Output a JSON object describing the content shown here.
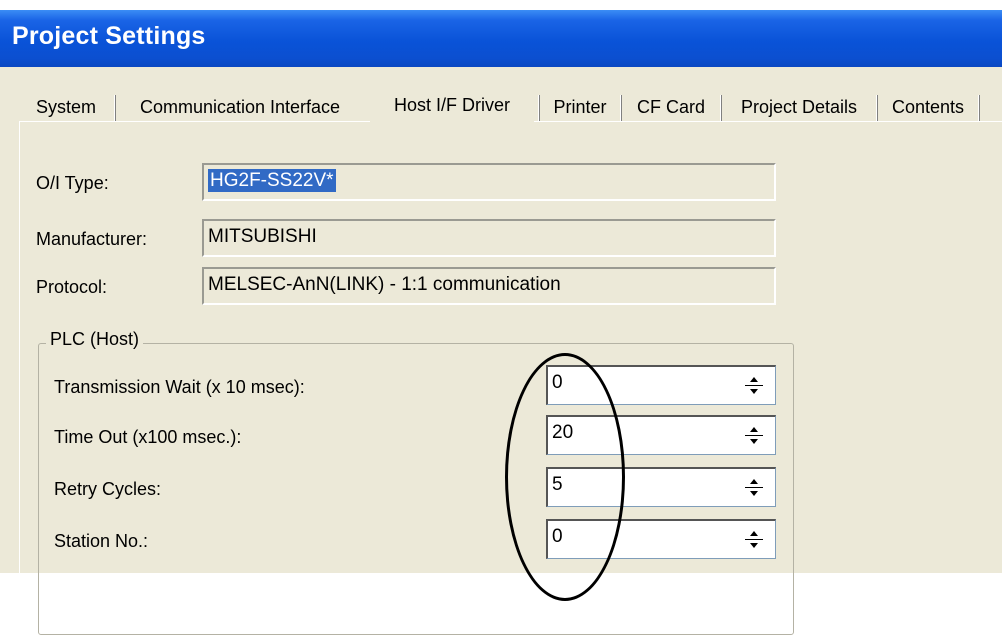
{
  "window": {
    "title": "Project Settings"
  },
  "tabs": [
    {
      "label": "System"
    },
    {
      "label": "Communication Interface"
    },
    {
      "label": "Host I/F Driver"
    },
    {
      "label": "Printer"
    },
    {
      "label": "CF Card"
    },
    {
      "label": "Project Details"
    },
    {
      "label": "Contents"
    }
  ],
  "active_tab": "Host I/F Driver",
  "host_driver": {
    "oi_type": {
      "label": "O/I Type:",
      "value": "HG2F-SS22V*"
    },
    "manufacturer": {
      "label": "Manufacturer:",
      "value": "MITSUBISHI"
    },
    "protocol": {
      "label": "Protocol:",
      "value": "MELSEC-AnN(LINK) - 1:1 communication"
    }
  },
  "plc": {
    "group_title": "PLC (Host)",
    "fields": [
      {
        "label": "Transmission Wait (x 10 msec):",
        "value": "0"
      },
      {
        "label": "Time Out (x100 msec.):",
        "value": "20"
      },
      {
        "label": "Retry Cycles:",
        "value": "5"
      },
      {
        "label": "Station No.:",
        "value": "0"
      }
    ]
  },
  "icons": {
    "spin_up": "triangle-up-icon",
    "spin_down": "triangle-down-icon"
  },
  "colors": {
    "titlebar": "#0a53d8",
    "panel": "#ece9d8",
    "selection": "#316ac5"
  }
}
